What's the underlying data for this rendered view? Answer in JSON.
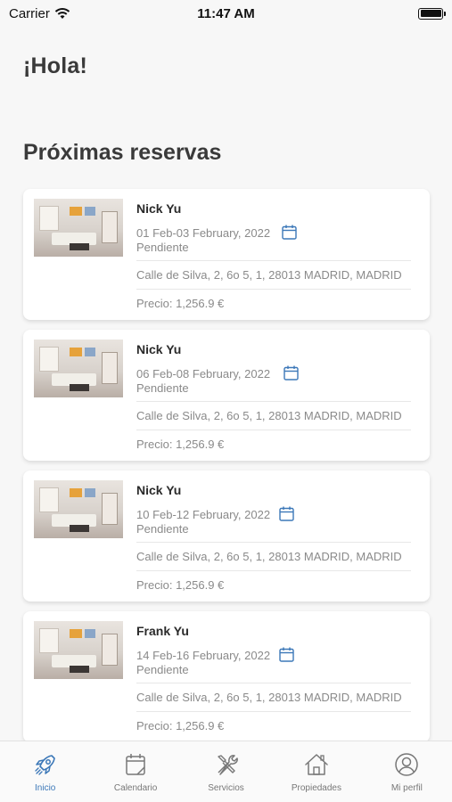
{
  "status_bar": {
    "carrier": "Carrier",
    "time": "11:47 AM"
  },
  "greeting": "¡Hola!",
  "section_title": "Próximas reservas",
  "price_prefix": "Precio:",
  "bookings": [
    {
      "guest": "Nick Yu",
      "dates": "01 Feb-03 February, 2022",
      "status": "Pendiente",
      "address": "Calle de Silva, 2, 6o 5, 1, 28013 MADRID, MADRID",
      "price": "Precio: 1,256.9 €"
    },
    {
      "guest": "Nick Yu",
      "dates": "06 Feb-08 February, 2022",
      "status": "Pendiente",
      "address": "Calle de Silva, 2, 6o 5, 1, 28013 MADRID, MADRID",
      "price": "Precio: 1,256.9 €"
    },
    {
      "guest": "Nick Yu",
      "dates": "10 Feb-12 February, 2022",
      "status": "Pendiente",
      "address": "Calle de Silva, 2, 6o 5, 1, 28013 MADRID, MADRID",
      "price": "Precio: 1,256.9 €"
    },
    {
      "guest": "Frank Yu",
      "dates": "14 Feb-16 February, 2022",
      "status": "Pendiente",
      "address": "Calle de Silva, 2, 6o 5, 1, 28013 MADRID, MADRID",
      "price": "Precio: 1,256.9 €"
    }
  ],
  "tabs": [
    {
      "label": "Inicio",
      "icon": "rocket-icon",
      "active": true
    },
    {
      "label": "Calendario",
      "icon": "calendar-icon",
      "active": false
    },
    {
      "label": "Servicios",
      "icon": "tools-icon",
      "active": false
    },
    {
      "label": "Propiedades",
      "icon": "house-icon",
      "active": false
    },
    {
      "label": "Mi perfil",
      "icon": "user-icon",
      "active": false
    }
  ],
  "colors": {
    "accent": "#3c78b8",
    "text_muted": "#8a8a8a",
    "background": "#f7f7f7"
  }
}
